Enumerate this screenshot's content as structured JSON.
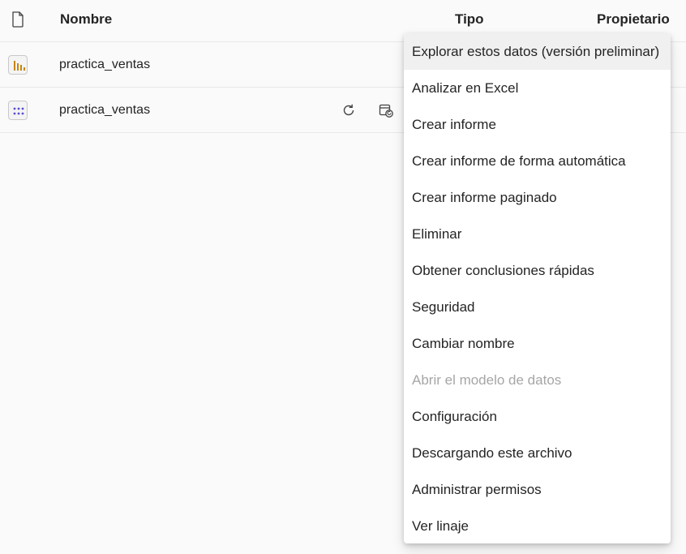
{
  "columns": {
    "name": "Nombre",
    "type": "Tipo",
    "owner": "Propietario"
  },
  "rows": [
    {
      "name": "practica_ventas",
      "icon": "report-bar-chart-icon"
    },
    {
      "name": "practica_ventas",
      "icon": "semantic-model-grid-icon"
    }
  ],
  "context_menu": {
    "items": [
      {
        "label": "Explorar estos datos (versión preliminar)",
        "enabled": true,
        "hovered": true
      },
      {
        "label": "Analizar en Excel",
        "enabled": true
      },
      {
        "label": "Crear informe",
        "enabled": true
      },
      {
        "label": "Crear informe de forma automática",
        "enabled": true
      },
      {
        "label": "Crear informe paginado",
        "enabled": true
      },
      {
        "label": "Eliminar",
        "enabled": true
      },
      {
        "label": "Obtener conclusiones rápidas",
        "enabled": true
      },
      {
        "label": "Seguridad",
        "enabled": true
      },
      {
        "label": "Cambiar nombre",
        "enabled": true
      },
      {
        "label": "Abrir el modelo de datos",
        "enabled": false
      },
      {
        "label": "Configuración",
        "enabled": true
      },
      {
        "label": "Descargando este archivo",
        "enabled": true
      },
      {
        "label": "Administrar permisos",
        "enabled": true
      },
      {
        "label": "Ver linaje",
        "enabled": true
      }
    ]
  },
  "colors": {
    "report_icon": "#c8850a",
    "model_icon": "#5a4fcf",
    "disabled_text": "#a6a6a6"
  }
}
